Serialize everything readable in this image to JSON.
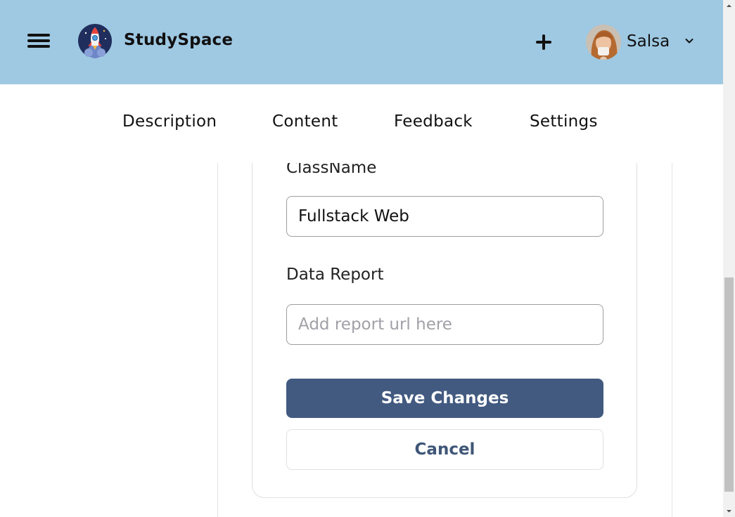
{
  "header": {
    "brand": "StudySpace",
    "user_name": "Salsa",
    "colors": {
      "header_bg": "#9fc8e2"
    }
  },
  "tabs": [
    {
      "label": "Description"
    },
    {
      "label": "Content"
    },
    {
      "label": "Feedback"
    },
    {
      "label": "Settings"
    }
  ],
  "form": {
    "class_name_label": "ClassName",
    "class_name_value": "Fullstack Web",
    "data_report_label": "Data Report",
    "data_report_value": "",
    "data_report_placeholder": "Add report url here",
    "save_label": "Save Changes",
    "cancel_label": "Cancel",
    "colors": {
      "primary": "#425a80"
    }
  },
  "icons": {
    "menu": "hamburger-icon",
    "logo": "rocket-logo",
    "add": "plus-icon",
    "dropdown": "chevron-down-icon"
  }
}
